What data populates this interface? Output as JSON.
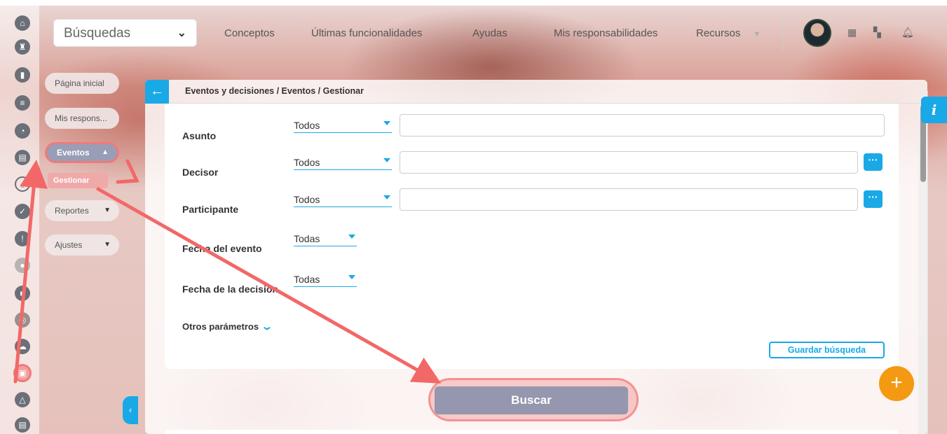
{
  "topnav": {
    "search_select": "Búsquedas",
    "links": [
      "Conceptos",
      "Últimas funcionalidades",
      "Ayudas",
      "Mis responsabilidades",
      "Recursos"
    ]
  },
  "sidebar": {
    "buttons": {
      "home": "Página inicial",
      "mis_respons": "Mis respons...",
      "eventos": "Eventos",
      "gestionar": "Gestionar",
      "reportes": "Reportes",
      "ajustes": "Ajustes"
    }
  },
  "panel": {
    "breadcrumb": "Eventos y decisiones / Eventos / Gestionar",
    "fields": {
      "asunto": {
        "label": "Asunto",
        "value": "Todos"
      },
      "decisor": {
        "label": "Decisor",
        "value": "Todos"
      },
      "participante": {
        "label": "Participante",
        "value": "Todos"
      },
      "fecha_evento": {
        "label": "Fecha del evento",
        "value": "Todas"
      },
      "fecha_decision": {
        "label": "Fecha de la decisión",
        "value": "Todas"
      }
    },
    "otros_parametros": "Otros parámetros",
    "save_search": "Guardar búsqueda",
    "buscar": "Buscar"
  },
  "colors": {
    "accent": "#19a9e6",
    "annotation": "#f26868",
    "fab": "#f39a12",
    "button_gray": "#9497ad"
  },
  "icons": [
    "home-icon",
    "chess-rook-icon",
    "bar-chart-icon",
    "list-icon",
    "pie-chart-icon",
    "document-icon",
    "cycle-icon",
    "check-circle-icon",
    "warning-icon",
    "calendar-icon",
    "network-icon",
    "info-icon",
    "plus-icon",
    "bell-icon",
    "map-icon"
  ]
}
